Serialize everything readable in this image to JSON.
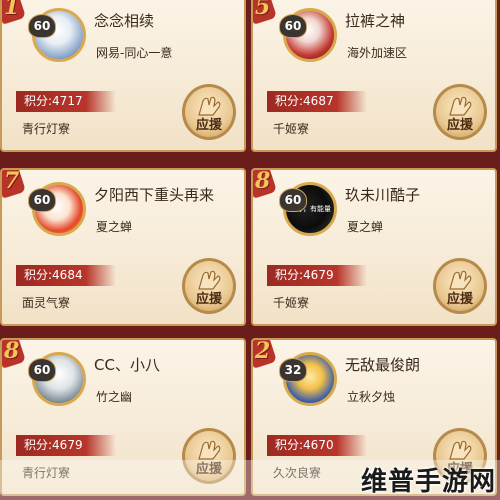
{
  "cards": [
    {
      "rank": "1",
      "level": "60",
      "name": "念念相续",
      "server": "网易-同心一意",
      "score": "积分:4717",
      "guild": "青行灯寮",
      "assist_label": "应援",
      "avatar_text": "",
      "avatar_style": "a1"
    },
    {
      "rank": "5",
      "level": "60",
      "name": "拉裤之神",
      "server": "海外加速区",
      "score": "积分:4687",
      "guild": "千姬寮",
      "assist_label": "应援",
      "avatar_text": "",
      "avatar_style": "a2"
    },
    {
      "rank": "7",
      "level": "60",
      "name": "夕阳西下重头再来",
      "server": "夏之蝉",
      "score": "积分:4684",
      "guild": "面灵气寮",
      "assist_label": "应援",
      "avatar_text": "",
      "avatar_style": "a3"
    },
    {
      "rank": "8",
      "level": "60",
      "name": "玖未川酷子",
      "server": "夏之蝉",
      "score": "积分:4679",
      "guild": "千姬寮",
      "assist_label": "应援",
      "avatar_text": "不好，有能量",
      "avatar_style": "a4"
    },
    {
      "rank": "8",
      "level": "60",
      "name": "CC、小八",
      "server": "竹之幽",
      "score": "积分:4679",
      "guild": "青行灯寮",
      "assist_label": "应援",
      "avatar_text": "",
      "avatar_style": "a5"
    },
    {
      "rank": "2",
      "level": "32",
      "name": "无敌最俊朗",
      "server": "立秋夕烛",
      "score": "积分:4670",
      "guild": "久次良寮",
      "assist_label": "应援",
      "avatar_text": "",
      "avatar_style": "a6"
    }
  ],
  "watermark": "维普手游网",
  "colors": {
    "accent": "#b8352b",
    "border": "#c79a58",
    "card_bg": "#f6ead6"
  },
  "icons": {
    "assist": "hand-icon"
  }
}
